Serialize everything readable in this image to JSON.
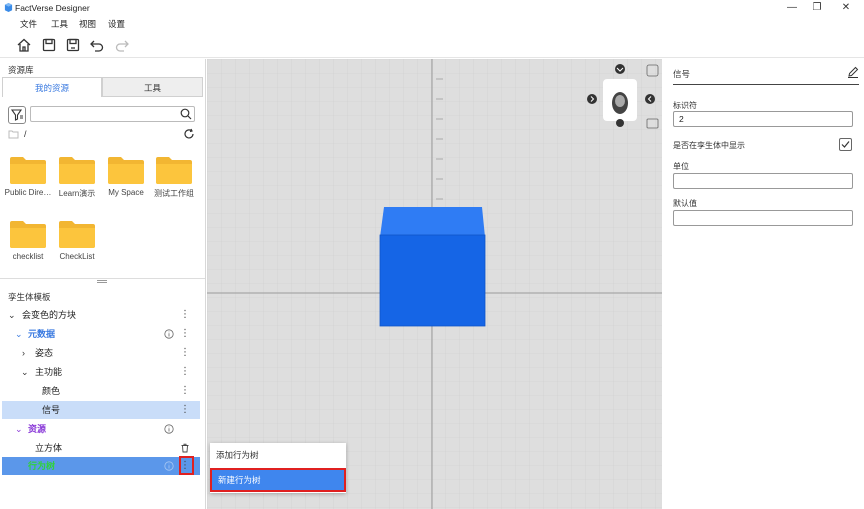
{
  "app": {
    "title": "FactVerse Designer"
  },
  "window": {
    "minimize": "—",
    "restore": "❐",
    "close": "✕"
  },
  "menu": [
    "文件",
    "工具",
    "视图",
    "设置"
  ],
  "resource": {
    "title": "资源库",
    "tabs": [
      "我的资源",
      "工具"
    ],
    "search_placeholder": "",
    "path": "/",
    "folders": [
      "Public Dire…",
      "Learn演示",
      "My Space",
      "测试工作组",
      "checklist",
      "CheckList"
    ]
  },
  "twin": {
    "title": "孪生体模板",
    "tree": [
      "会变色的方块",
      "元数据",
      "姿态",
      "主功能",
      "颜色",
      "信号",
      "资源",
      "立方体",
      "行为树"
    ]
  },
  "context_menu": [
    "添加行为树",
    "新建行为树"
  ],
  "properties": {
    "title": "信号",
    "id_label": "标识符",
    "id_value": "2",
    "show_label": "是否在孪生体中显示",
    "unit_label": "单位",
    "unit_value": "",
    "default_label": "默认值",
    "default_value": ""
  },
  "colors": {
    "accent": "#3a7ae0",
    "cube": "#1565e6",
    "selection": "#c9ddf9",
    "highlight": "#e02020"
  }
}
